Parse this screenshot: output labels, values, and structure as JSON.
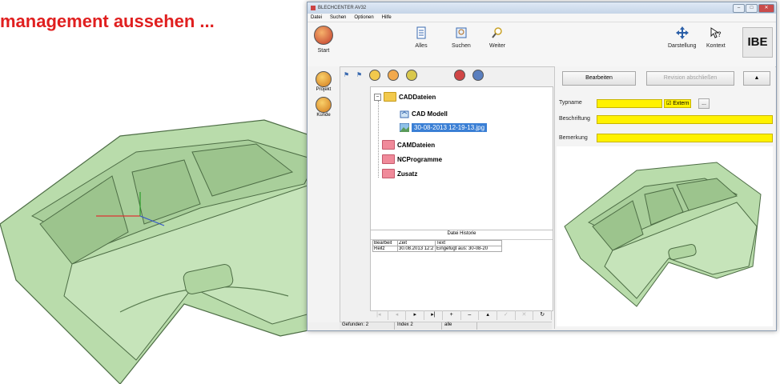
{
  "headline": "management aussehen ...",
  "window": {
    "title": "BLECHCENTER AV32",
    "menu": [
      "Datei",
      "Suchen",
      "Optionen",
      "Hilfe"
    ],
    "toolbar": {
      "start": "Start",
      "alles": "Alles",
      "suchen": "Suchen",
      "weiter": "Weiter",
      "darstellung": "Darstellung",
      "kontext": "Kontext",
      "logo": "IBE"
    },
    "sidebar": {
      "projekt": "Projekt",
      "kunde": "Kunde"
    },
    "tree": {
      "cad_dateien": "CADDateien",
      "cad_modell": "CAD Modell",
      "jpg_file": "30-08-2013 12-19-13.jpg",
      "cam_dateien": "CAMDateien",
      "nc_programme": "NCProgramme",
      "zusatz": "Zusatz"
    },
    "history": {
      "title": "Datei Historie",
      "columns": [
        "Bearbeit",
        "Zeit",
        "Text"
      ],
      "rows": [
        [
          "Reitz",
          "30.08.2013 12:2",
          "Eingefügt aus: 30-08-20"
        ]
      ]
    },
    "status": {
      "gefunden": "Gefunden: 2",
      "index": "Index 2",
      "filter": "alle"
    },
    "right": {
      "bearbeiten": "Bearbeiten",
      "revision": "Revision abschließen",
      "up_arrow": "▲",
      "typname_label": "Typname",
      "extern_label": "Extern",
      "extern_btn": "...",
      "beschriftung_label": "Beschriftung",
      "bemerkung_label": "Bemerkung"
    },
    "colors": {
      "headline": "#e01f1f",
      "field_yellow": "#fff200",
      "selection": "#3a7fd5",
      "cad_green": "#b8dcaa"
    }
  }
}
